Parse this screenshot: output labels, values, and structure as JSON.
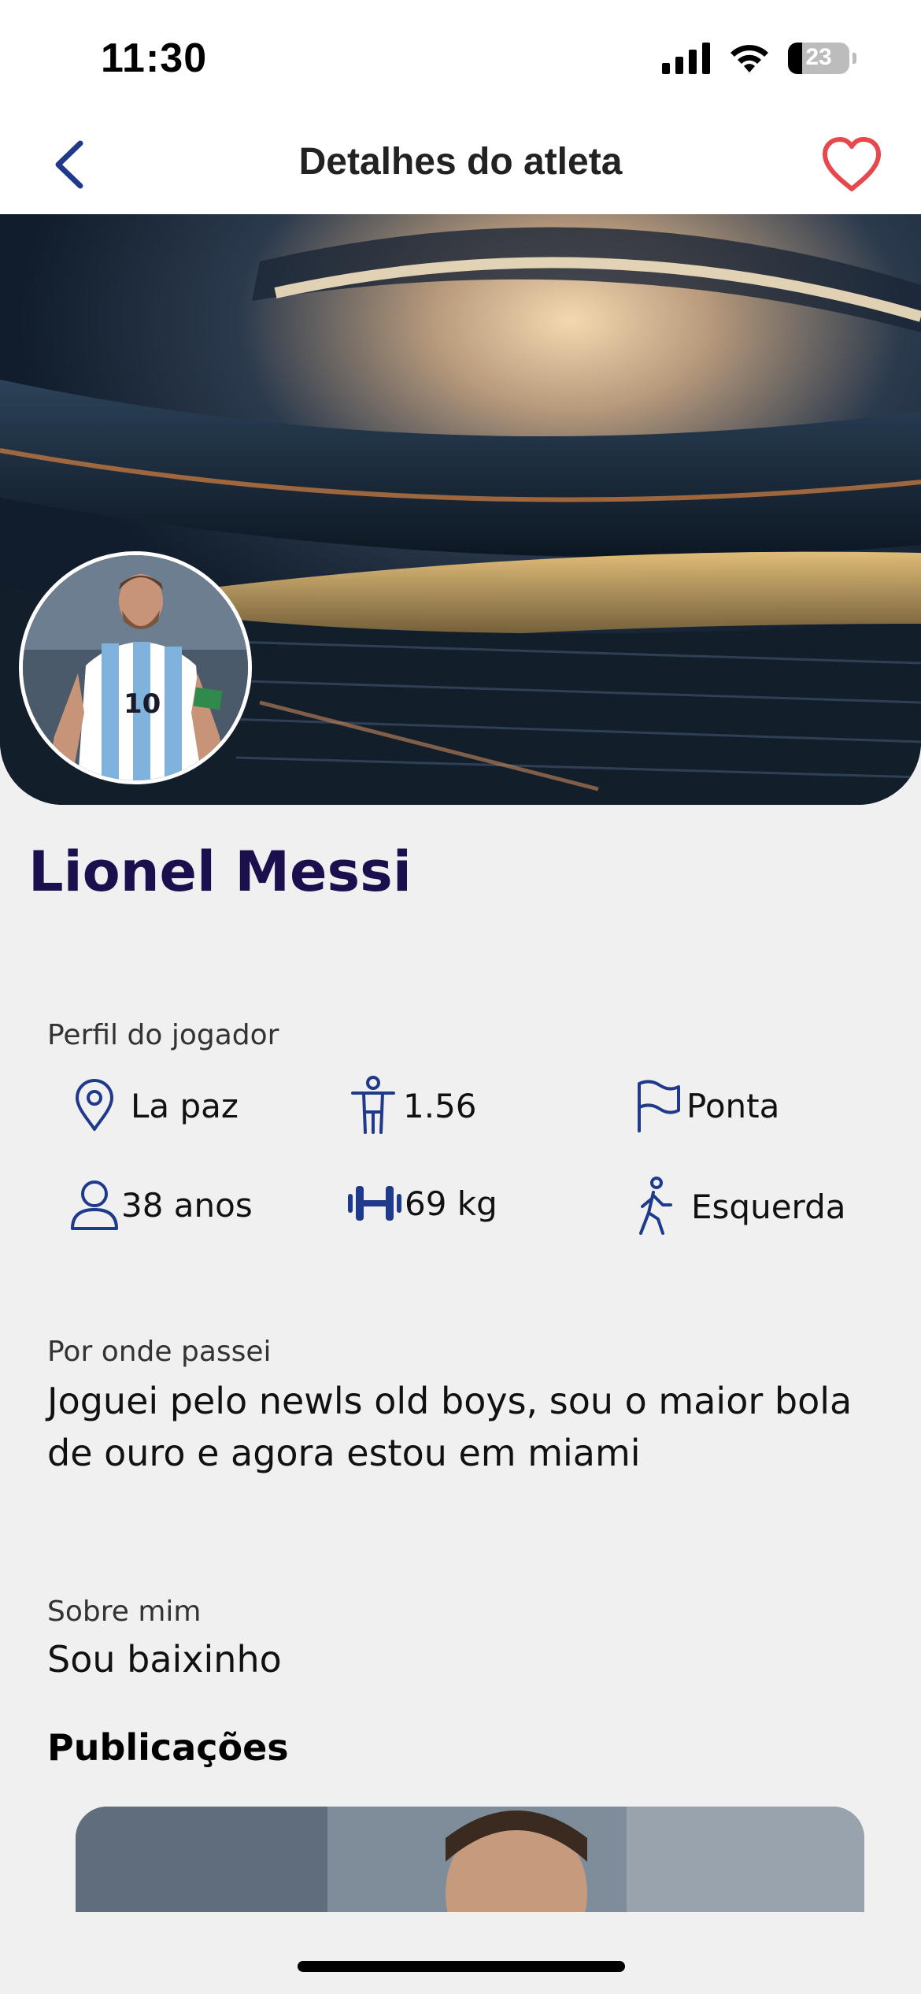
{
  "status_bar": {
    "time": "11:30",
    "battery": "23"
  },
  "nav": {
    "title": "Detalhes do atleta",
    "back_icon": "chevron-left-icon",
    "favorite_icon": "heart-outline-icon"
  },
  "athlete": {
    "name": "Lionel Messi"
  },
  "profile": {
    "label": "Perfil do jogador",
    "items": [
      {
        "icon": "location-pin-icon",
        "value": "La paz"
      },
      {
        "icon": "person-height-icon",
        "value": "1.56"
      },
      {
        "icon": "flag-icon",
        "value": "Ponta"
      },
      {
        "icon": "user-icon",
        "value": "38 anos"
      },
      {
        "icon": "dumbbell-icon",
        "value": "69 kg"
      },
      {
        "icon": "walking-icon",
        "value": "Esquerda"
      }
    ]
  },
  "history": {
    "label": "Por onde passei",
    "text": "Joguei pelo newls old boys, sou o maior bola de ouro e agora estou em miami"
  },
  "about": {
    "label": "Sobre mim",
    "text": "Sou baixinho"
  },
  "publications": {
    "title": "Publicações"
  },
  "colors": {
    "accent": "#1f3a8a",
    "heart": "#e5484d",
    "name": "#1c0f4e"
  }
}
